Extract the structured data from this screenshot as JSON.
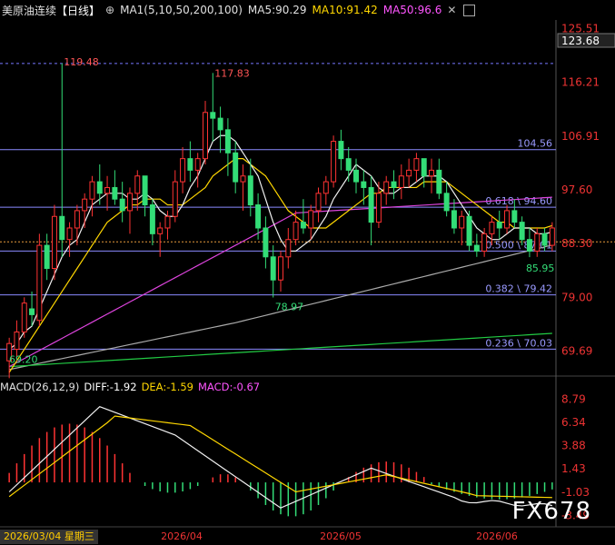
{
  "header": {
    "title": "美原油连续",
    "period": "【日线】",
    "ma_params": "MA1(5,10,50,200,100)",
    "ma5": "MA5:90.29",
    "ma10": "MA10:91.42",
    "ma50": "MA50:96.6",
    "colors": {
      "title": "#e0e0e0",
      "period": "#ffffff",
      "ma_params": "#e0e0e0",
      "ma5": "#e0e0e0",
      "ma10": "#ffd700",
      "ma50": "#ff55ff"
    }
  },
  "macd_header": {
    "label": "MACD(26,12,9)",
    "diff": "DIFF:-1.92",
    "dea": "DEA:-1.59",
    "macd": "MACD:-0.67"
  },
  "price_axis": [
    "125.51",
    "116.21",
    "106.91",
    "97.60",
    "88.30",
    "79.00",
    "69.69"
  ],
  "current_price": "123.68",
  "macd_axis": [
    "8.79",
    "6.34",
    "3.88",
    "1.43",
    "-1.03",
    "-3.49"
  ],
  "x_labels": [
    "2026/04",
    "2026/05",
    "2026/06"
  ],
  "date_badge": "2026/03/04 星期三",
  "watermark": "FX678",
  "annotations": {
    "high1": "119.48",
    "high2": "117.83",
    "low1": "78.97",
    "low_start": "69.20",
    "low_recent": "85.95"
  },
  "levels": [
    {
      "label": "104.56",
      "value": 104.56
    },
    {
      "label": "0.618 \\ 94.60",
      "value": 94.6
    },
    {
      "label": "0.500 \\ 87.01",
      "value": 87.01
    },
    {
      "label": "0.382 \\ 79.42",
      "value": 79.42
    },
    {
      "label": "0.236 \\ 70.03",
      "value": 70.03
    }
  ],
  "reference_line": {
    "value": 119.48
  },
  "chart_data": {
    "type": "candlestick",
    "title": "美原油连续",
    "candles": [
      [
        68,
        72,
        65,
        71
      ],
      [
        70,
        75,
        68,
        73
      ],
      [
        73,
        79,
        72,
        78
      ],
      [
        77,
        80,
        74,
        76
      ],
      [
        75,
        90,
        74,
        88
      ],
      [
        88,
        90,
        82,
        84
      ],
      [
        84,
        95,
        82,
        93
      ],
      [
        93,
        119.48,
        86,
        89
      ],
      [
        89,
        92,
        86,
        91
      ],
      [
        91,
        95,
        88,
        94
      ],
      [
        94,
        97,
        91,
        96
      ],
      [
        96,
        100,
        93,
        99
      ],
      [
        99,
        102,
        95,
        97
      ],
      [
        97,
        100,
        94,
        98
      ],
      [
        98,
        101,
        95,
        96
      ],
      [
        96,
        99,
        92,
        94
      ],
      [
        94,
        98,
        90,
        97
      ],
      [
        97,
        101,
        94,
        100
      ],
      [
        100,
        99,
        93,
        95
      ],
      [
        95,
        96,
        88,
        90
      ],
      [
        90,
        92,
        86,
        91
      ],
      [
        91,
        94,
        89,
        93
      ],
      [
        93,
        101,
        92,
        99
      ],
      [
        99,
        105,
        97,
        103
      ],
      [
        103,
        106,
        99,
        101
      ],
      [
        101,
        104,
        98,
        103
      ],
      [
        103,
        113,
        102,
        111
      ],
      [
        111,
        117.83,
        106,
        110
      ],
      [
        110,
        112,
        104,
        108
      ],
      [
        108,
        110,
        100,
        104
      ],
      [
        104,
        106,
        97,
        99
      ],
      [
        99,
        102,
        94,
        100
      ],
      [
        100,
        103,
        93,
        95
      ],
      [
        95,
        97,
        89,
        91
      ],
      [
        91,
        93,
        84,
        86
      ],
      [
        86,
        88,
        78.97,
        82
      ],
      [
        82,
        87,
        80,
        86
      ],
      [
        86,
        91,
        84,
        89
      ],
      [
        89,
        94,
        88,
        92
      ],
      [
        92,
        96,
        90,
        91
      ],
      [
        91,
        95,
        89,
        94
      ],
      [
        94,
        98,
        92,
        97
      ],
      [
        97,
        100,
        95,
        99
      ],
      [
        99,
        107,
        98,
        106
      ],
      [
        106,
        108,
        101,
        103
      ],
      [
        103,
        105,
        99,
        101
      ],
      [
        101,
        103,
        97,
        99
      ],
      [
        99,
        101,
        95,
        98
      ],
      [
        98,
        100,
        88,
        92
      ],
      [
        92,
        99,
        91,
        97
      ],
      [
        97,
        100,
        95,
        99
      ],
      [
        99,
        101,
        96,
        98
      ],
      [
        98,
        102,
        96,
        100
      ],
      [
        100,
        103,
        98,
        101
      ],
      [
        101,
        104,
        99,
        103
      ],
      [
        103,
        102,
        98,
        100
      ],
      [
        100,
        103,
        97,
        101
      ],
      [
        101,
        103,
        96,
        97
      ],
      [
        97,
        99,
        93,
        94
      ],
      [
        94,
        96,
        90,
        91
      ],
      [
        91,
        94,
        88,
        93
      ],
      [
        93,
        94,
        87,
        88
      ],
      [
        88,
        90,
        86,
        87
      ],
      [
        87,
        91,
        86,
        90
      ],
      [
        90,
        93,
        88,
        92
      ],
      [
        92,
        94,
        89,
        91
      ],
      [
        91,
        95,
        90,
        94
      ],
      [
        94,
        96,
        91,
        92
      ],
      [
        92,
        93,
        88,
        89
      ],
      [
        89,
        91,
        85.95,
        87
      ],
      [
        87,
        91,
        86,
        90
      ],
      [
        90,
        91,
        87,
        88
      ],
      [
        88,
        92,
        87,
        91
      ]
    ],
    "ma5": [
      70,
      71,
      73,
      74,
      77,
      80,
      83,
      86,
      88,
      89,
      92,
      95,
      96,
      97,
      97,
      97,
      96,
      96,
      97,
      96,
      94,
      93,
      93,
      95,
      98,
      100,
      103,
      106,
      107,
      107,
      106,
      104,
      102,
      100,
      96,
      92,
      89,
      87,
      87,
      88,
      89,
      91,
      93,
      96,
      98,
      100,
      102,
      101,
      100,
      98,
      97,
      97,
      98,
      98,
      99,
      100,
      100,
      100,
      99,
      97,
      95,
      93,
      91,
      90,
      89,
      89,
      90,
      91,
      91,
      91,
      90,
      90,
      90.29
    ],
    "ma10": [
      66,
      68,
      70,
      72,
      74,
      76,
      78,
      80,
      82,
      84,
      86,
      88,
      90,
      92,
      93,
      94,
      95,
      95,
      96,
      96,
      96,
      95,
      95,
      95,
      96,
      97,
      98,
      100,
      101,
      102,
      103,
      103,
      102,
      101,
      100,
      98,
      96,
      94,
      93,
      92,
      91,
      91,
      91,
      92,
      93,
      94,
      95,
      96,
      97,
      97,
      98,
      98,
      98,
      98,
      98,
      99,
      99,
      99,
      99,
      98,
      97,
      96,
      95,
      94,
      93,
      92,
      92,
      91,
      91,
      91,
      91,
      91,
      91.42
    ],
    "ma50": [],
    "xlabel": "",
    "ylabel": "",
    "ylim": [
      66,
      127
    ]
  }
}
